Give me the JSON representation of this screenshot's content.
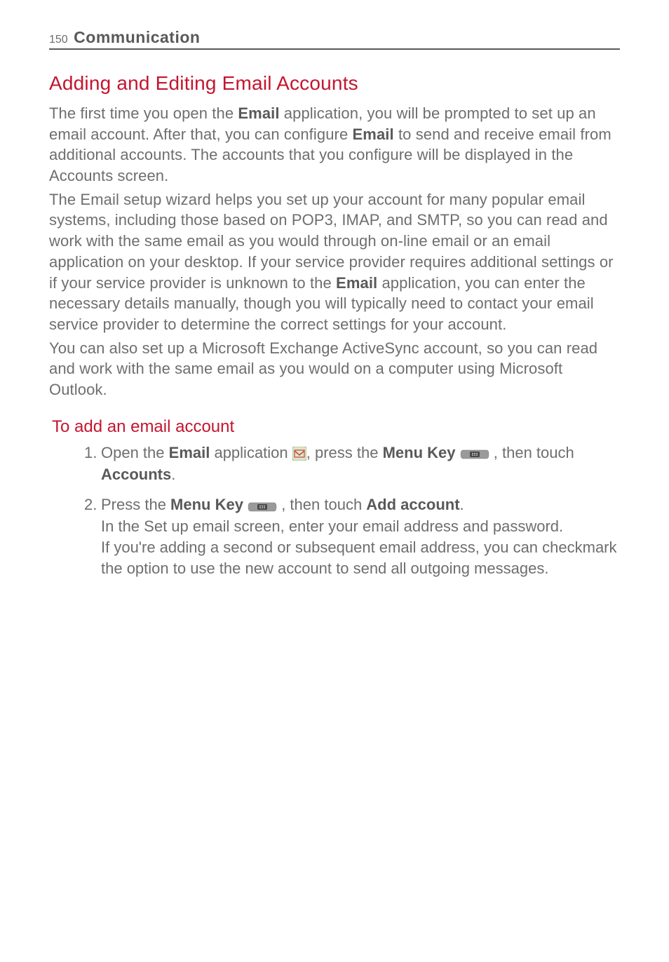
{
  "header": {
    "page_number": "150",
    "chapter": "Communication"
  },
  "section": {
    "title": "Adding and Editing Email Accounts",
    "p1a": "The first time you open the ",
    "p1b": "Email",
    "p1c": " application, you will be prompted to set up an email account. After that, you can configure ",
    "p1d": "Email",
    "p1e": " to send and receive email from additional accounts. The accounts that you configure will be displayed in the Accounts screen.",
    "p2a": "The Email setup wizard helps you set up your account for many popular email systems, including those based on POP3, IMAP, and SMTP, so you can read and work with the same email as you would through on-line email or an email application on your desktop. If your service provider requires additional settings or if your service provider is unknown to the ",
    "p2b": "Email",
    "p2c": " application, you can enter the necessary details manually, though you will typically need to contact your email service provider to determine the correct settings for your account.",
    "p3": "You can also set up a Microsoft Exchange ActiveSync account, so you can read and work with the same email as you would on a computer using Microsoft Outlook."
  },
  "sub": {
    "title": "To add an email account",
    "step1": {
      "num": "1.",
      "a": "Open the ",
      "b": "Email",
      "c": " application ",
      "d": ", press the ",
      "e": "Menu Key",
      "f": " ",
      "g": " , then touch ",
      "h": "Accounts",
      "i": "."
    },
    "step2": {
      "num": "2.",
      "a": "Press the ",
      "b": "Menu Key",
      "c": " ",
      "d": " , then touch ",
      "e": "Add account",
      "f": ".",
      "g": "In the Set up email screen, enter your email address and password.",
      "h": "If you're adding a second or subsequent email address, you can checkmark the option to use the new account to send all outgoing messages."
    }
  }
}
